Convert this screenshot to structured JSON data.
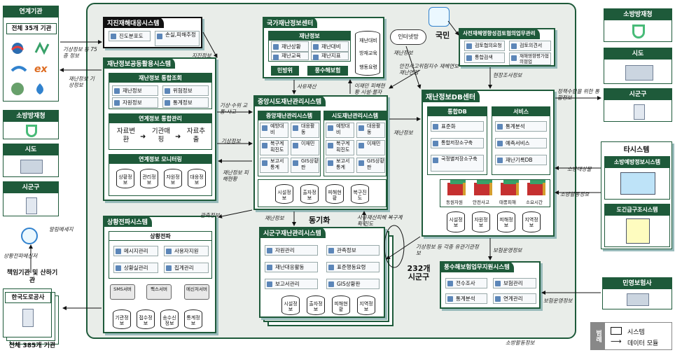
{
  "main_area": {
    "color": "#e9ede9",
    "border": "#1e5a3a"
  },
  "left_top": {
    "title": "연계기관",
    "inner": "전체 35개 기관"
  },
  "left_mid": {
    "items": [
      "소방방재청",
      "시도",
      "시군구"
    ]
  },
  "left_bottom": {
    "title": "책임기관 및 산하기관",
    "inner": "한국도로공사",
    "footer": "전체 385개 기관"
  },
  "right_top": {
    "items": [
      "소방방재청",
      "시도",
      "시군구"
    ]
  },
  "right_other": {
    "title": "타시스템",
    "items": [
      "소방예방정보시스템",
      "도긴급구조시스템"
    ]
  },
  "right_insurer": {
    "title": "민영보험사"
  },
  "people": {
    "label": "국민",
    "cloud": "인터넷망"
  },
  "disaster_response": {
    "title": "지진재해대응시스템",
    "items": [
      "진도분포도",
      "손실,피해추정"
    ]
  },
  "info_sharing": {
    "title": "재난정보공동활용시스템",
    "inquiry": {
      "title": "재난정보 통합조회",
      "items": [
        "재난정보",
        "위험정보",
        "자원정보",
        "통계정보"
      ]
    },
    "link_mgmt": {
      "title": "연계정보 통합관리",
      "steps": [
        "자료변환",
        "기관매핑",
        "자료추출"
      ]
    },
    "monitor": {
      "title": "연계정보 모니터링",
      "dbs": [
        "상황정보",
        "관리정보",
        "자원정보",
        "대응정보"
      ]
    }
  },
  "propagation": {
    "title": "상황전파시스템",
    "inner_title": "상황전파",
    "items": [
      "메시지관리",
      "사용자지원",
      "상황실관리",
      "집계관리"
    ],
    "servers": [
      "SMS서버",
      "팩스서버",
      "메신저서버"
    ],
    "dbs": [
      "기관정보",
      "접수정보",
      "송수신정보",
      "통계정보"
    ]
  },
  "national_center": {
    "title": "국가재난정보센터",
    "inner_title": "재난정보",
    "items": [
      "재난상황",
      "재난대비",
      "재난교육",
      "재난지표"
    ],
    "stack": [
      "재난대비",
      "방재교육",
      "행동요령"
    ],
    "buttons": [
      "민방위",
      "풍수해보험"
    ]
  },
  "central_system": {
    "title": "중앙시도재난관리시스템",
    "central": {
      "title": "중앙재난관리시스템",
      "items": [
        "예방대비",
        "대응활동",
        "복구계획진도",
        "이재민",
        "보고서통계",
        "GIS상황판"
      ]
    },
    "provincial": {
      "title": "시도재난관리시스템",
      "items": [
        "예방대비",
        "대응활동",
        "복구계획진도",
        "이재민",
        "보고서통계",
        "GIS상황판"
      ]
    },
    "dbs": [
      "시설정보",
      "출자정보",
      "피해현황",
      "복구진도"
    ]
  },
  "county_system": {
    "title": "시군구재난관리시스템",
    "items": [
      "자원관리",
      "관측정보",
      "재난대응활동",
      "표준행동요령",
      "보고서관리",
      "GIS상황판"
    ],
    "dbs": [
      "시설정보",
      "출자정보",
      "피해현황",
      "지역정보"
    ],
    "count_label": "232개 시군구",
    "sync_label": "동기화"
  },
  "pre_review": {
    "title": "사전재해영향성검토협의업무관리",
    "items": [
      "검토협의요청",
      "검토의견서",
      "통합검색",
      "재해영향평가협의협업"
    ]
  },
  "db_center": {
    "title": "재난정보DB센터",
    "integrated": {
      "title": "통합DB",
      "items": [
        "표준화",
        "통합저장소구축",
        "국정별저장소구축"
      ]
    },
    "service": {
      "title": "서비스",
      "items": [
        "통계분석",
        "예측서비스",
        "재난기록DB"
      ]
    },
    "cubes": [
      "동원자원",
      "안전사고",
      "태풍피해",
      "소요시간"
    ],
    "dbs": [
      "시설정보",
      "자원정보",
      "피해정보",
      "지역정보"
    ]
  },
  "insurance": {
    "title": "풍수해보험업무지원시스템",
    "items": [
      "전수조사",
      "보험관리",
      "통계분석",
      "연계관리"
    ]
  },
  "flows": {
    "weather": "기상정보 등 75종 정보",
    "eq_info": "지진정보",
    "disaster_weather": "재난정보 기상정보",
    "weather_water": "기상·수위 교통·사고",
    "weather_info": "기상정보",
    "disaster_damage": "재난정보 피해현황",
    "observation": "관측정보",
    "alert": "알림메세지",
    "propagation_msg": "상황전파메신저",
    "case_file": "사유재산",
    "disaster_status": "재난정보",
    "safety": "안전사고위험지수 재해연보 재난연감",
    "onsite": "현장조사정보",
    "policy": "정책수립을 위한 통합정보",
    "prevention": "소방대상물",
    "activity": "소방활동정보",
    "insurance_ops": "보험운영정보",
    "insurer_ops": "보험운영정보",
    "weather_rules": "기상정보 등 각종 유관기관정보",
    "disaster_info2": "재난정보",
    "private_damage": "이재민 피해현황 시설·물자",
    "private_prop": "사유재산피해 복구계획·진도",
    "fire_ops": "소방활동정보"
  },
  "legend": {
    "title": "범례",
    "system": "시스템",
    "data": "데이터 모듈"
  },
  "icons": {
    "leaf": "leaf-icon",
    "building": "building-icon",
    "monitor": "monitor-icon",
    "cloud": "cloud-icon",
    "person": "person-icon",
    "server": "server-icon",
    "cube": "cube-icon",
    "database": "database-icon"
  }
}
